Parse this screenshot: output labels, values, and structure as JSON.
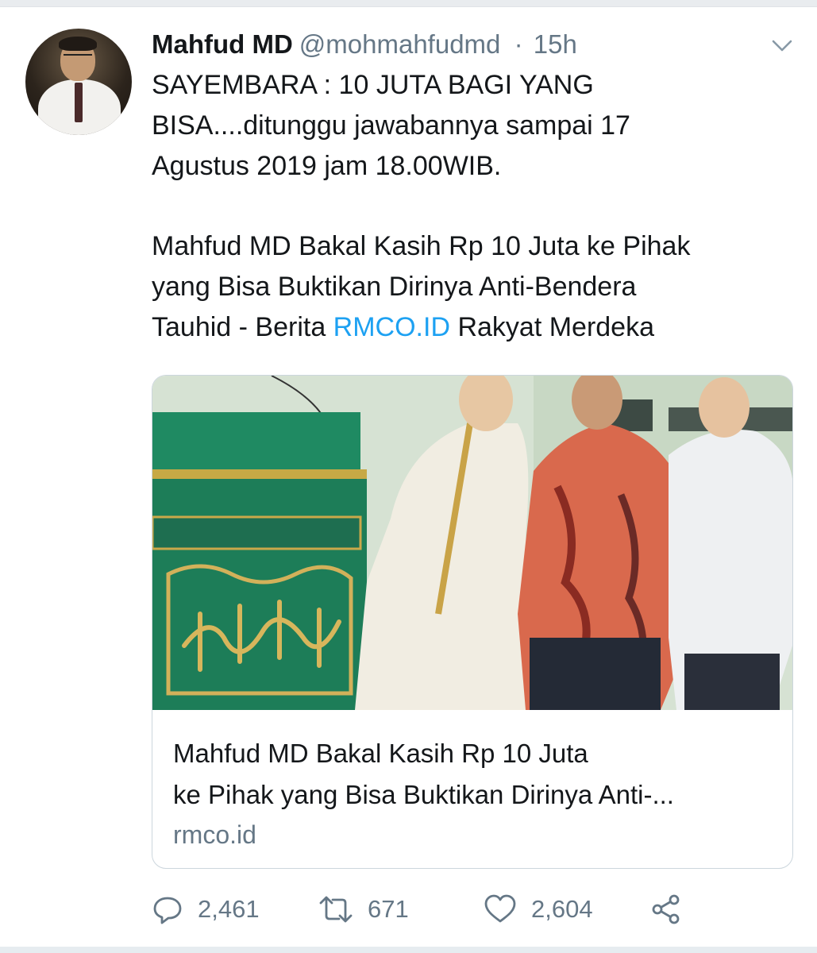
{
  "tweet": {
    "author_name": "Mahfud MD",
    "author_handle": "@mohmahfudmd",
    "separator": "·",
    "timestamp": "15h",
    "text_lines": [
      "SAYEMBARA : 10 JUTA BAGI YANG",
      "BISA....ditunggu jawabannya sampai 17",
      "Agustus 2019 jam 18.00WIB."
    ],
    "headline_lines": [
      "Mahfud MD Bakal Kasih Rp 10 Juta ke Pihak",
      "yang Bisa Buktikan Dirinya Anti-Bendera"
    ],
    "last_line_prefix": "Tauhid - Berita ",
    "last_line_link": "RMCO.ID",
    "last_line_suffix": " Rakyat Merdeka"
  },
  "card": {
    "title_lines": [
      "Mahfud MD Bakal Kasih Rp 10 Juta",
      "ke Pihak yang Bisa Buktikan Dirinya Anti-..."
    ],
    "domain": "rmco.id"
  },
  "actions": {
    "reply_count": "2,461",
    "retweet_count": "671",
    "like_count": "2,604"
  },
  "icons": {
    "menu": "chevron-down-icon",
    "reply": "reply-icon",
    "retweet": "retweet-icon",
    "like": "heart-icon",
    "share": "share-icon"
  },
  "colors": {
    "link": "#1da1f2",
    "secondary_text": "#657786",
    "primary_text": "#14171a"
  }
}
